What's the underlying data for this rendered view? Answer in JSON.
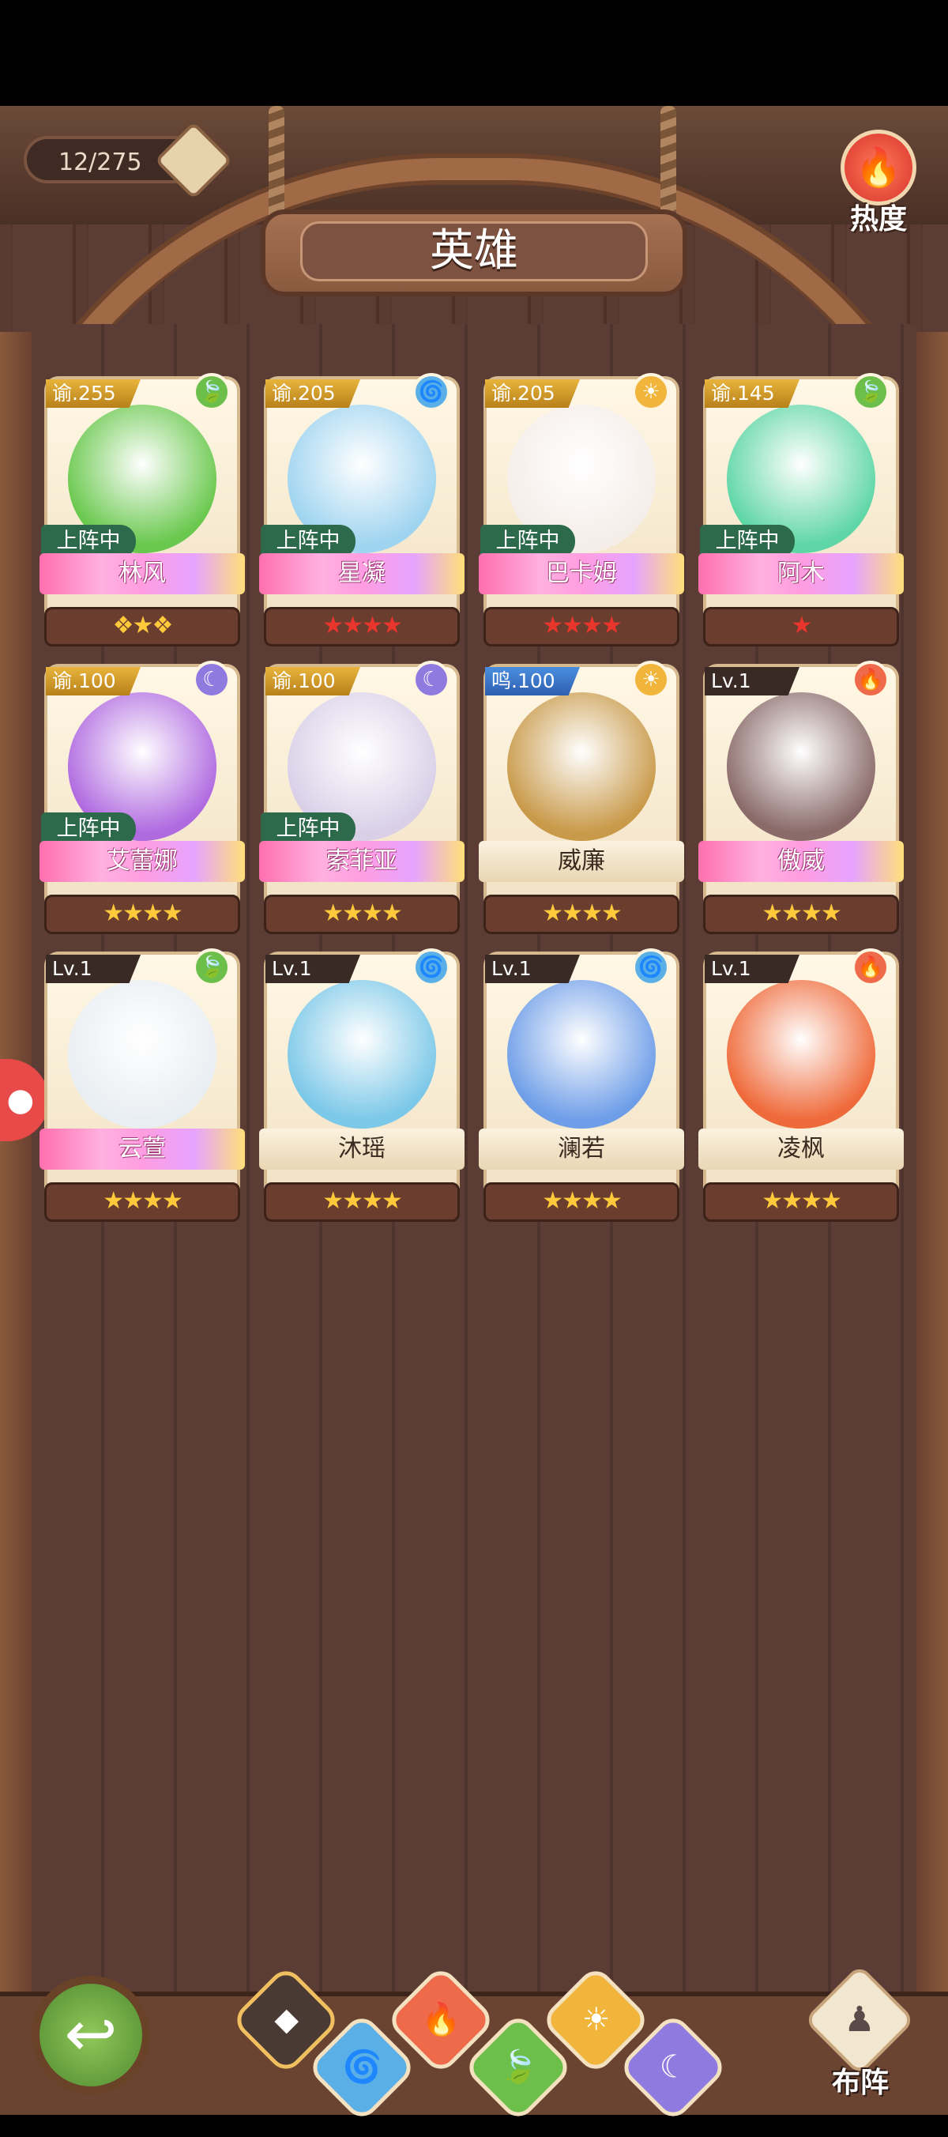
{
  "header": {
    "count": "12/275",
    "title": "英雄",
    "hot_label": "热度"
  },
  "heroes": [
    {
      "name": "林风",
      "level": "谕.255",
      "element": "grass",
      "deployed": "上阵中",
      "stars": "wing-badge",
      "level_style": "gold"
    },
    {
      "name": "星凝",
      "level": "谕.205",
      "element": "water",
      "deployed": "上阵中",
      "stars": "★★★★",
      "level_style": "gold",
      "star_color": "red"
    },
    {
      "name": "巴卡姆",
      "level": "谕.205",
      "element": "light",
      "deployed": "上阵中",
      "stars": "★★★★",
      "level_style": "gold",
      "star_color": "red"
    },
    {
      "name": "阿木",
      "level": "谕.145",
      "element": "grass",
      "deployed": "上阵中",
      "stars": "★",
      "level_style": "gold",
      "star_color": "red"
    },
    {
      "name": "艾蕾娜",
      "level": "谕.100",
      "element": "dark",
      "deployed": "上阵中",
      "stars": "★★★★",
      "level_style": "gold"
    },
    {
      "name": "索菲亚",
      "level": "谕.100",
      "element": "dark",
      "deployed": "上阵中",
      "stars": "★★★★",
      "level_style": "gold"
    },
    {
      "name": "威廉",
      "level": "鸣.100",
      "element": "light",
      "deployed": "",
      "stars": "★★★★",
      "level_style": "blue"
    },
    {
      "name": "傲威",
      "level": "Lv.1",
      "element": "fire",
      "deployed": "",
      "stars": "★★★★",
      "level_style": "dark"
    },
    {
      "name": "云萱",
      "level": "Lv.1",
      "element": "grass",
      "deployed": "",
      "stars": "★★★★",
      "level_style": "dark"
    },
    {
      "name": "沐瑶",
      "level": "Lv.1",
      "element": "water",
      "deployed": "",
      "stars": "★★★★",
      "level_style": "dark"
    },
    {
      "name": "澜若",
      "level": "Lv.1",
      "element": "water",
      "deployed": "",
      "stars": "★★★★",
      "level_style": "dark"
    },
    {
      "name": "凌枫",
      "level": "Lv.1",
      "element": "fire",
      "deployed": "",
      "stars": "★★★★",
      "level_style": "dark"
    }
  ],
  "bottom": {
    "formation_label": "布阵",
    "tabs": [
      "all-icon",
      "water-icon",
      "fire-icon",
      "grass-icon",
      "light-icon",
      "dark-icon"
    ]
  },
  "colors": {
    "grass": "#6cbf4a",
    "water": "#5ab0e6",
    "light": "#f0b53a",
    "dark": "#8f7ae0",
    "fire": "#ef6a4a"
  }
}
